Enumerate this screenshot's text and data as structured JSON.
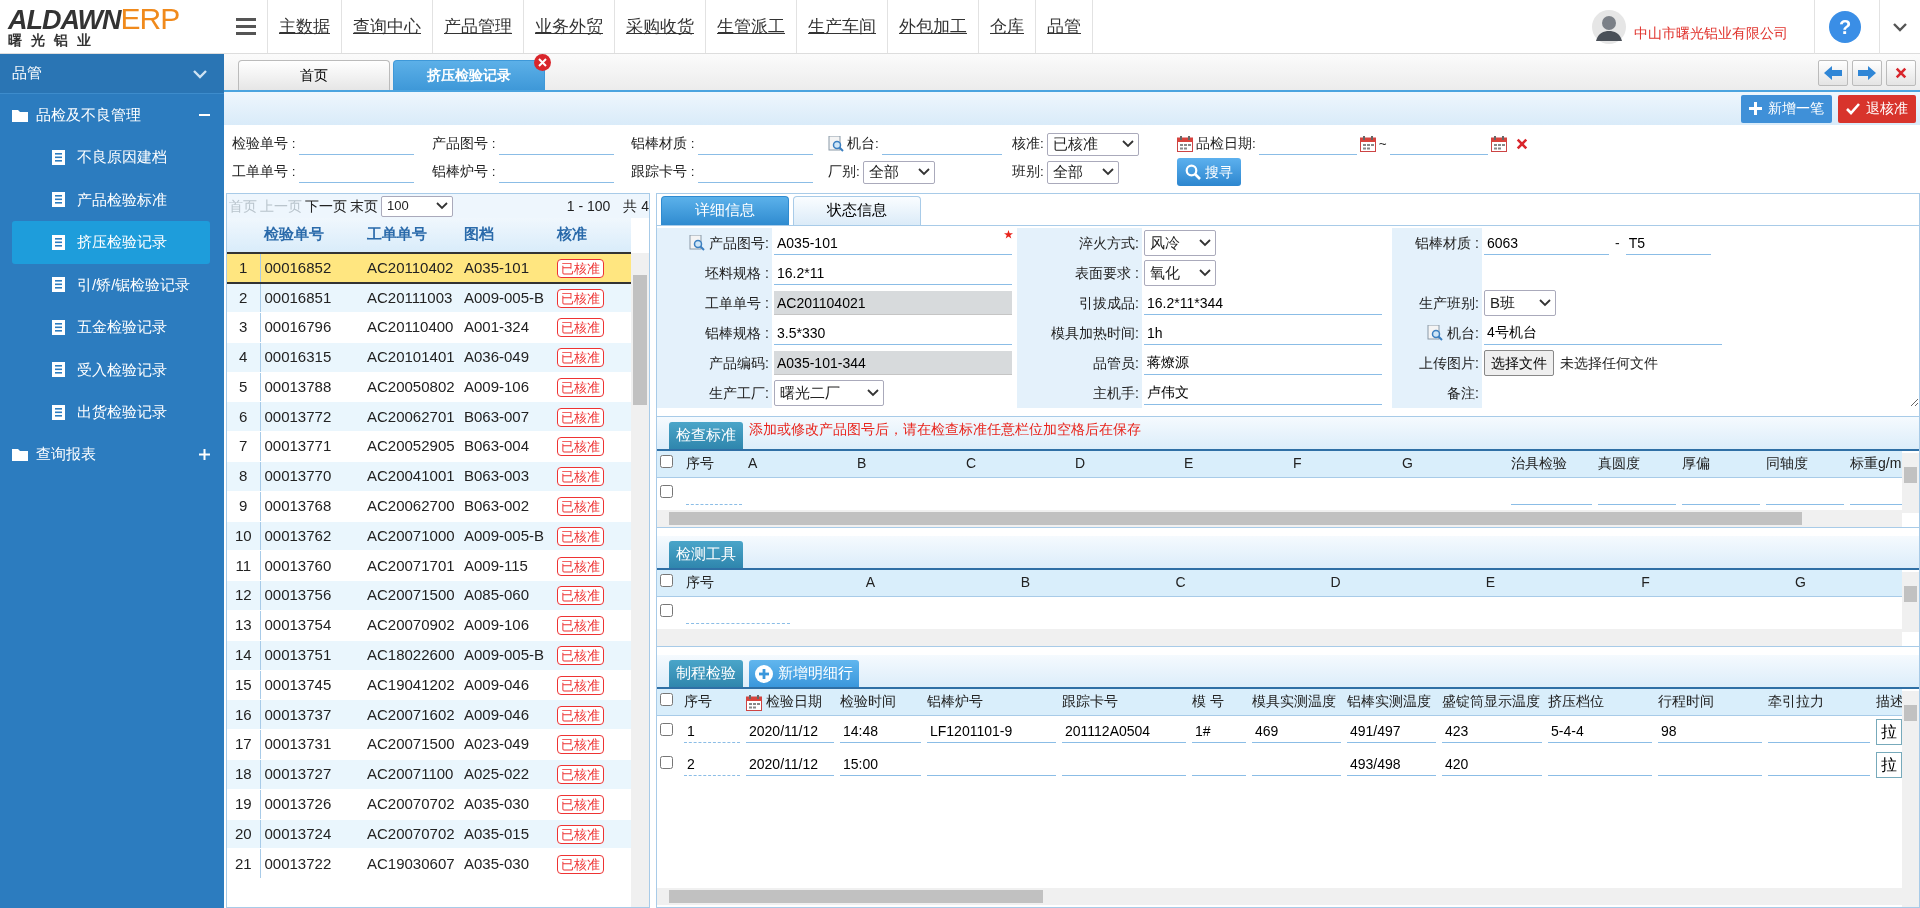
{
  "header": {
    "logo": {
      "brand": "ALDAWN",
      "suffix": "ERP",
      "tagline": "曙光铝业"
    },
    "menu": [
      "主数据",
      "查询中心",
      "产品管理",
      "业务外贸",
      "采购收货",
      "生管派工",
      "生产车间",
      "外包加工",
      "仓库",
      "品管"
    ],
    "company": "中山市曙光铝业有限公司",
    "help": "?"
  },
  "sidebar": {
    "title": "品管",
    "groups": [
      {
        "label": "品检及不良管理",
        "expanded": true,
        "items": [
          {
            "label": "不良原因建档",
            "selected": false
          },
          {
            "label": "产品检验标准",
            "selected": false
          },
          {
            "label": "挤压检验记录",
            "selected": true
          },
          {
            "label": "引/矫/锯检验记录",
            "selected": false
          },
          {
            "label": "五金检验记录",
            "selected": false
          },
          {
            "label": "受入检验记录",
            "selected": false
          },
          {
            "label": "出货检验记录",
            "selected": false
          }
        ]
      },
      {
        "label": "查询报表",
        "expanded": false
      }
    ]
  },
  "tabs": [
    {
      "label": "首页",
      "selected": false,
      "closable": false
    },
    {
      "label": "挤压检验记录",
      "selected": true,
      "closable": true
    }
  ],
  "toolbar": [
    {
      "label": "新增一笔",
      "kind": "add"
    },
    {
      "label": "退核准",
      "kind": "revoke"
    }
  ],
  "filters": [
    [
      {
        "label": "检验单号 :",
        "kind": "text"
      },
      {
        "label": "产品图号 :",
        "kind": "text"
      },
      {
        "label": "铝棒材质 :",
        "kind": "text"
      },
      {
        "label": "机台:",
        "kind": "lookup"
      },
      {
        "label": "核准:",
        "kind": "select",
        "value": "已核准"
      },
      {
        "label": "品检日期:",
        "kind": "date-range",
        "separator": "~"
      }
    ],
    [
      {
        "label": "工单单号 :",
        "kind": "text"
      },
      {
        "label": "铝棒炉号 :",
        "kind": "text"
      },
      {
        "label": "跟踪卡号 :",
        "kind": "text"
      },
      {
        "label": "厂别:",
        "kind": "select",
        "value": "全部"
      },
      {
        "label": "班别:",
        "kind": "select",
        "value": "全部"
      },
      {
        "label": "搜寻",
        "kind": "button"
      }
    ]
  ],
  "list": {
    "pager": [
      {
        "label": "首页",
        "disabled": true
      },
      {
        "label": "上一页",
        "disabled": true
      },
      {
        "label": "下一页",
        "disabled": false
      },
      {
        "label": "末页",
        "disabled": false
      }
    ],
    "page_size": "100",
    "range": "1 - 100",
    "total": "共 4",
    "columns": [
      "检验单号",
      "工单单号",
      "图档",
      "核准"
    ],
    "rows": [
      {
        "no": "1",
        "cells": [
          "00016852",
          "AC20110402",
          "A035-101",
          "已核准"
        ],
        "selected": true
      },
      {
        "no": "2",
        "cells": [
          "00016851",
          "AC20111003",
          "A009-005-B",
          "已核准"
        ],
        "selected": false
      },
      {
        "no": "3",
        "cells": [
          "00016796",
          "AC20110400",
          "A001-324",
          "已核准"
        ],
        "selected": false
      },
      {
        "no": "4",
        "cells": [
          "00016315",
          "AC20101401",
          "A036-049",
          "已核准"
        ],
        "selected": false
      },
      {
        "no": "5",
        "cells": [
          "00013788",
          "AC20050802",
          "A009-106",
          "已核准"
        ],
        "selected": false
      },
      {
        "no": "6",
        "cells": [
          "00013772",
          "AC20062701",
          "B063-007",
          "已核准"
        ],
        "selected": false
      },
      {
        "no": "7",
        "cells": [
          "00013771",
          "AC20052905",
          "B063-004",
          "已核准"
        ],
        "selected": false
      },
      {
        "no": "8",
        "cells": [
          "00013770",
          "AC20041001",
          "B063-003",
          "已核准"
        ],
        "selected": false
      },
      {
        "no": "9",
        "cells": [
          "00013768",
          "AC20062700",
          "B063-002",
          "已核准"
        ],
        "selected": false
      },
      {
        "no": "10",
        "cells": [
          "00013762",
          "AC20071000",
          "A009-005-B",
          "已核准"
        ],
        "selected": false
      },
      {
        "no": "11",
        "cells": [
          "00013760",
          "AC20071701",
          "A009-115",
          "已核准"
        ],
        "selected": false
      },
      {
        "no": "12",
        "cells": [
          "00013756",
          "AC20071500",
          "A085-060",
          "已核准"
        ],
        "selected": false
      },
      {
        "no": "13",
        "cells": [
          "00013754",
          "AC20070902",
          "A009-106",
          "已核准"
        ],
        "selected": false
      },
      {
        "no": "14",
        "cells": [
          "00013751",
          "AC18022600",
          "A009-005-B",
          "已核准"
        ],
        "selected": false
      },
      {
        "no": "15",
        "cells": [
          "00013745",
          "AC19041202",
          "A009-046",
          "已核准"
        ],
        "selected": false
      },
      {
        "no": "16",
        "cells": [
          "00013737",
          "AC20071602",
          "A009-046",
          "已核准"
        ],
        "selected": false
      },
      {
        "no": "17",
        "cells": [
          "00013731",
          "AC20071500",
          "A023-049",
          "已核准"
        ],
        "selected": false
      },
      {
        "no": "18",
        "cells": [
          "00013727",
          "AC20071100",
          "A025-022",
          "已核准"
        ],
        "selected": false
      },
      {
        "no": "19",
        "cells": [
          "00013726",
          "AC20070702",
          "A035-030",
          "已核准"
        ],
        "selected": false
      },
      {
        "no": "20",
        "cells": [
          "00013724",
          "AC20070702",
          "A035-015",
          "已核准"
        ],
        "selected": false
      },
      {
        "no": "21",
        "cells": [
          "00013722",
          "AC19030607",
          "A035-030",
          "已核准"
        ],
        "selected": false
      }
    ]
  },
  "detail": {
    "tabs": [
      {
        "label": "详细信息",
        "selected": true
      },
      {
        "label": "状态信息",
        "selected": false
      }
    ],
    "rows": [
      [
        {
          "label": "产品图号:",
          "kind": "lookup",
          "value": "A035-101",
          "required": true
        },
        {
          "label": "淬火方式:",
          "kind": "select",
          "value": "风冷"
        },
        {
          "label": "铝棒材质 :",
          "kind": "range",
          "value": "6063",
          "separator": "-",
          "value2": "T5"
        }
      ],
      [
        {
          "label": "坯料规格 :",
          "kind": "text",
          "value": "16.2*11"
        },
        {
          "label": "表面要求 :",
          "kind": "select",
          "value": "氧化"
        },
        null
      ],
      [
        {
          "label": "工单单号 :",
          "kind": "readonly",
          "value": "AC201104021"
        },
        {
          "label": "引拔成品:",
          "kind": "text",
          "value": "16.2*11*344"
        },
        {
          "label": "生产班别:",
          "kind": "select",
          "value": "B班"
        }
      ],
      [
        {
          "label": "铝棒规格 :",
          "kind": "text",
          "value": "3.5*330"
        },
        {
          "label": "模具加热时间:",
          "kind": "text",
          "value": "1h"
        },
        {
          "label": "机台:",
          "kind": "lookup",
          "value": "4号机台"
        }
      ],
      [
        {
          "label": "产品编码:",
          "kind": "readonly",
          "value": "A035-101-344"
        },
        {
          "label": "品管员:",
          "kind": "text",
          "value": "蒋燎源"
        },
        {
          "label": "上传图片:",
          "kind": "file",
          "value": "选择文件",
          "status": "未选择任何文件"
        }
      ],
      [
        {
          "label": "生产工厂:",
          "kind": "select",
          "value": "曙光二厂"
        },
        {
          "label": "主机手:",
          "kind": "text",
          "value": "卢伟文"
        },
        {
          "label": "备注:",
          "kind": "textarea"
        }
      ]
    ]
  },
  "sections": [
    {
      "kind": "standard",
      "title": "检查标准",
      "note": "添加或修改产品图号后，请在检查标准任意栏位加空格后在保存",
      "all_checked": false,
      "columns": [
        "序号",
        "A",
        "B",
        "C",
        "D",
        "E",
        "F",
        "G",
        "治具检验",
        "真圆度",
        "厚偏",
        "同轴度",
        "标重g/m"
      ],
      "rows": [
        {
          "checked": false
        }
      ]
    },
    {
      "kind": "tools",
      "title": "检测工具",
      "all_checked": false,
      "columns": [
        "序号",
        "A",
        "B",
        "C",
        "D",
        "E",
        "F",
        "G"
      ],
      "rows": [
        {
          "checked": false
        }
      ]
    },
    {
      "kind": "process",
      "title": "制程检验",
      "add_button": "新增明细行",
      "all_checked": false,
      "columns": [
        "序号",
        "检验日期",
        "检验时间",
        "铝棒炉号",
        "跟踪卡号",
        "模 号",
        "模具实测温度",
        "铝棒实测温度",
        "盛锭筒显示温度",
        "挤压档位",
        "行程时间",
        "牵引拉力",
        "描述"
      ],
      "rows": [
        {
          "checked": false,
          "cells": [
            "1",
            "2020/11/12",
            "14:48",
            "LF1201101-9",
            "201112A0504",
            "1#",
            "469",
            "491/497",
            "423",
            "5-4-4",
            "98",
            null,
            "拉"
          ]
        },
        {
          "checked": false,
          "cells": [
            "2",
            "2020/11/12",
            "15:00",
            null,
            null,
            null,
            null,
            "493/498",
            "420",
            null,
            null,
            null,
            "拉"
          ]
        }
      ]
    }
  ]
}
